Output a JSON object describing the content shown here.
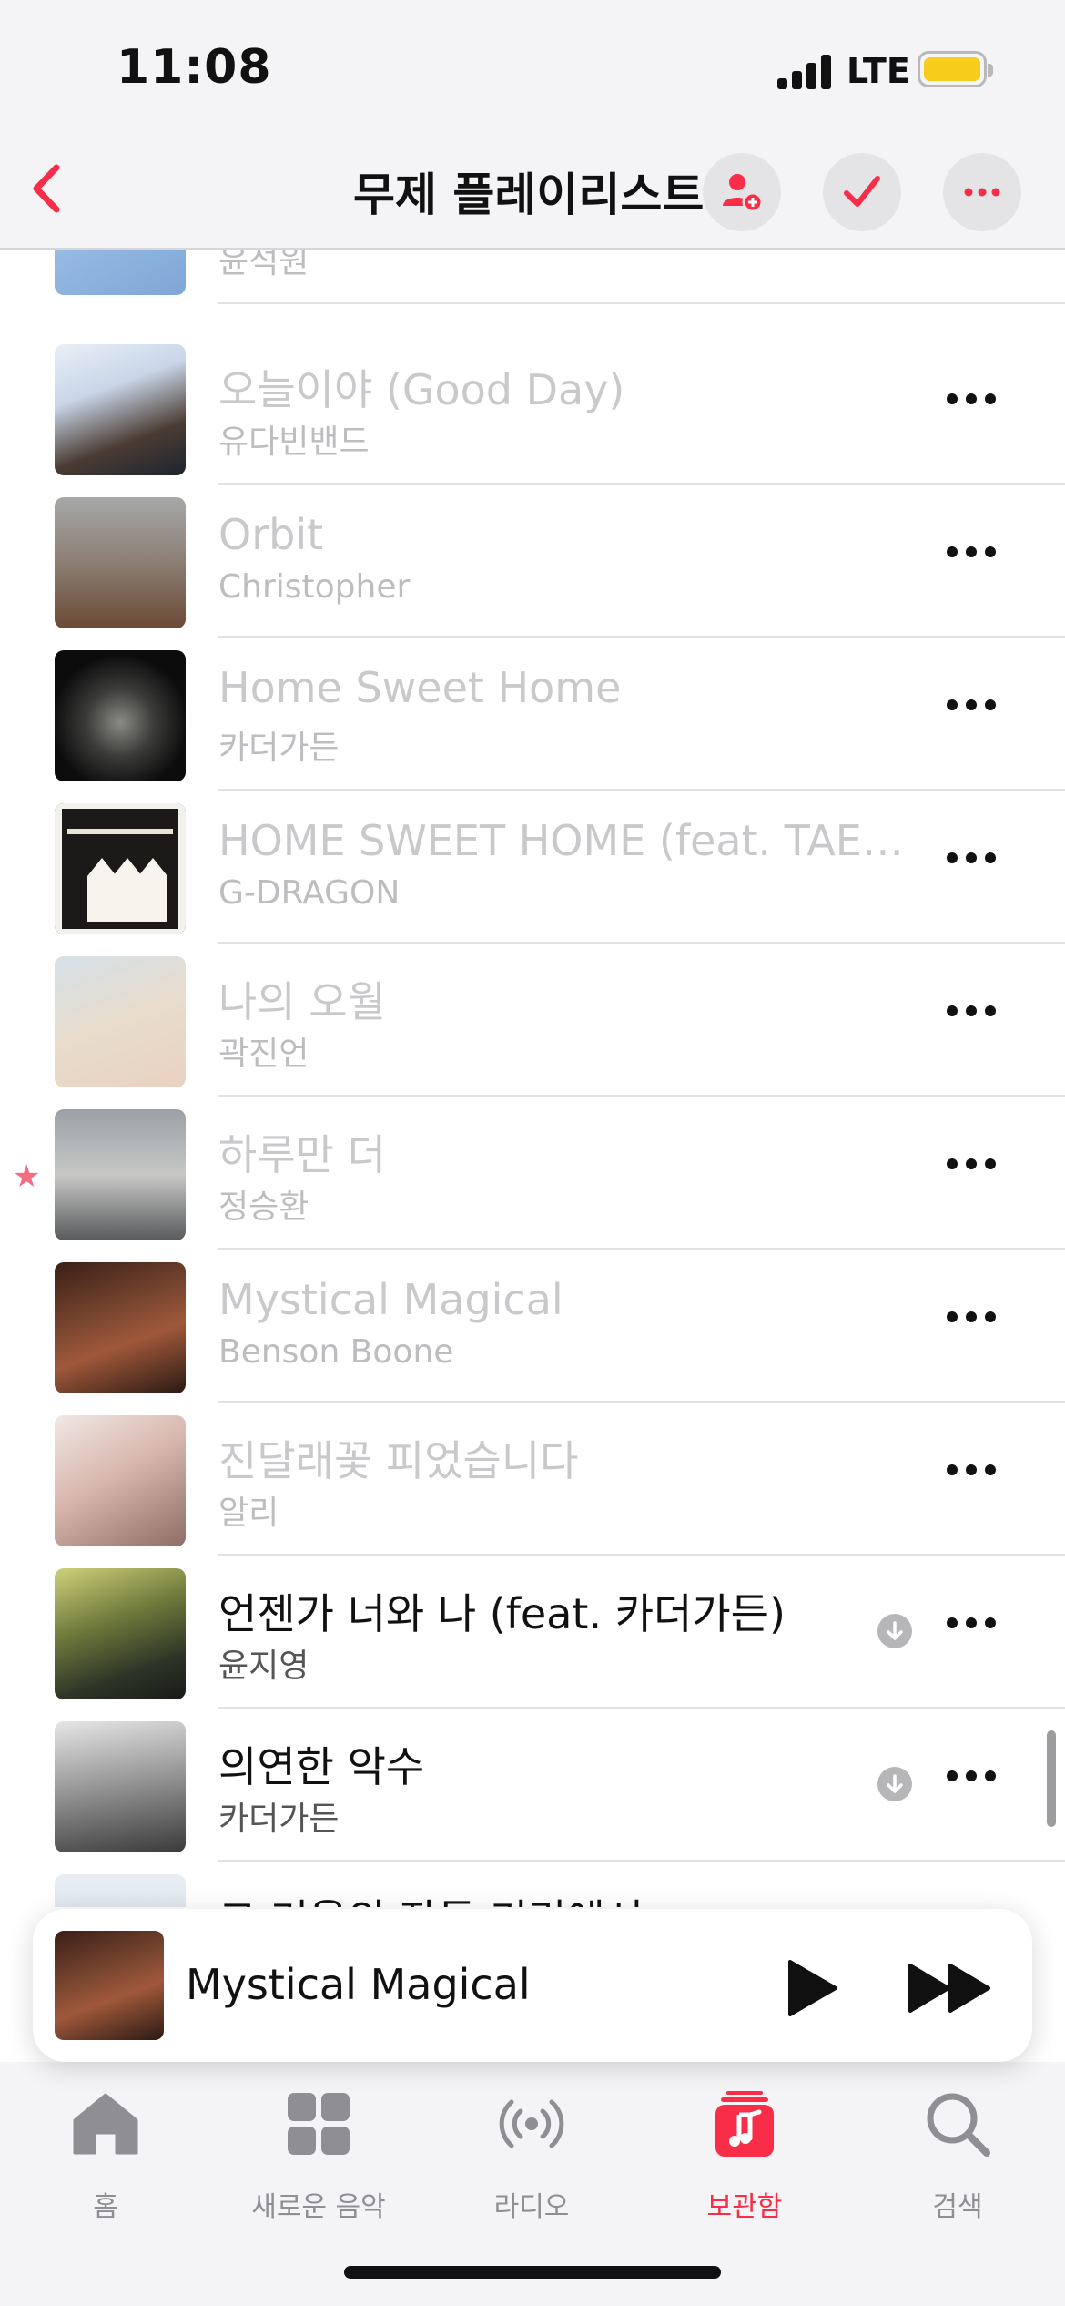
{
  "status_bar": {
    "time": "11:08",
    "network": "LTE",
    "battery_color": "#f7cc1a"
  },
  "nav": {
    "title": "무제 플레이리스트",
    "accent_color": "#fa2d48",
    "icons": [
      "chevron-left-icon",
      "add-person-icon",
      "checkmark-icon",
      "ellipsis-icon"
    ]
  },
  "songs": [
    {
      "title": "",
      "artist": "윤석원",
      "downloaded": false,
      "starred": false
    },
    {
      "title": "오늘이야 (Good Day)",
      "artist": "유다빈밴드",
      "downloaded": false,
      "starred": false
    },
    {
      "title": "Orbit",
      "artist": "Christopher",
      "downloaded": false,
      "starred": false
    },
    {
      "title": "Home Sweet Home",
      "artist": "카더가든",
      "downloaded": false,
      "starred": false
    },
    {
      "title": "HOME SWEET HOME (feat. TAEY...",
      "artist": "G-DRAGON",
      "downloaded": false,
      "starred": false
    },
    {
      "title": "나의 오월",
      "artist": "곽진언",
      "downloaded": false,
      "starred": false
    },
    {
      "title": "하루만 더",
      "artist": "정승환",
      "downloaded": false,
      "starred": true
    },
    {
      "title": "Mystical Magical",
      "artist": "Benson Boone",
      "downloaded": false,
      "starred": false
    },
    {
      "title": "진달래꽃 피었습니다",
      "artist": "알리",
      "downloaded": false,
      "starred": false
    },
    {
      "title": "언젠가 너와 나 (feat. 카더가든)",
      "artist": "윤지영",
      "downloaded": true,
      "starred": false
    },
    {
      "title": "의연한 악수",
      "artist": "카더가든",
      "downloaded": true,
      "starred": false
    },
    {
      "title": "그 겨울의 잔등 기리에서",
      "artist": "",
      "downloaded": false,
      "starred": false
    }
  ],
  "player": {
    "now_playing": "Mystical Magical"
  },
  "tabs": [
    {
      "label": "홈",
      "icon": "home-icon",
      "selected": false
    },
    {
      "label": "새로운 음악",
      "icon": "grid-icon",
      "selected": false
    },
    {
      "label": "라디오",
      "icon": "radio-icon",
      "selected": false
    },
    {
      "label": "보관함",
      "icon": "library-icon",
      "selected": true
    },
    {
      "label": "검색",
      "icon": "search-icon",
      "selected": false
    }
  ]
}
